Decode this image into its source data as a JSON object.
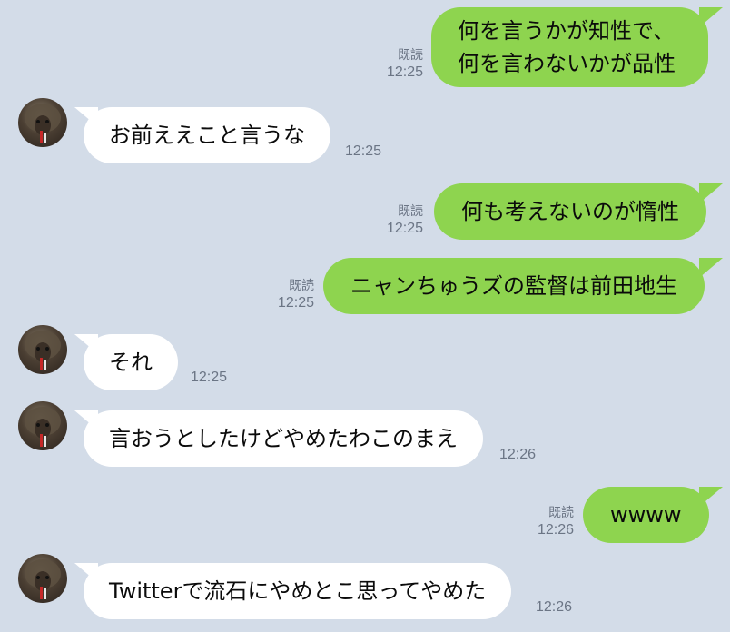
{
  "messages": [
    {
      "side": "out",
      "lines": [
        "何を言うかが知性で、",
        "何を言わないかが品性"
      ],
      "read": "既読",
      "time": "12:25"
    },
    {
      "side": "in",
      "text": "お前ええこと言うな",
      "time": "12:25"
    },
    {
      "side": "out",
      "text": "何も考えないのが惰性",
      "read": "既読",
      "time": "12:25"
    },
    {
      "side": "out",
      "text": "ニャンちゅうズの監督は前田地生",
      "read": "既読",
      "time": "12:25"
    },
    {
      "side": "in",
      "text": "それ",
      "time": "12:25"
    },
    {
      "side": "in",
      "text": "言おうとしたけどやめたわこのまえ",
      "time": "12:26"
    },
    {
      "side": "out",
      "text": "wwww",
      "read": "既読",
      "time": "12:26"
    },
    {
      "side": "in",
      "text": "Twitterで流石にやめとこ思ってやめた",
      "time": "12:26"
    }
  ],
  "colors": {
    "background": "#d3dce8",
    "outgoing": "#8ed44f",
    "incoming": "#ffffff",
    "meta": "#6b7585"
  },
  "icons": {
    "avatar": "hedgehog-avatar-icon"
  }
}
